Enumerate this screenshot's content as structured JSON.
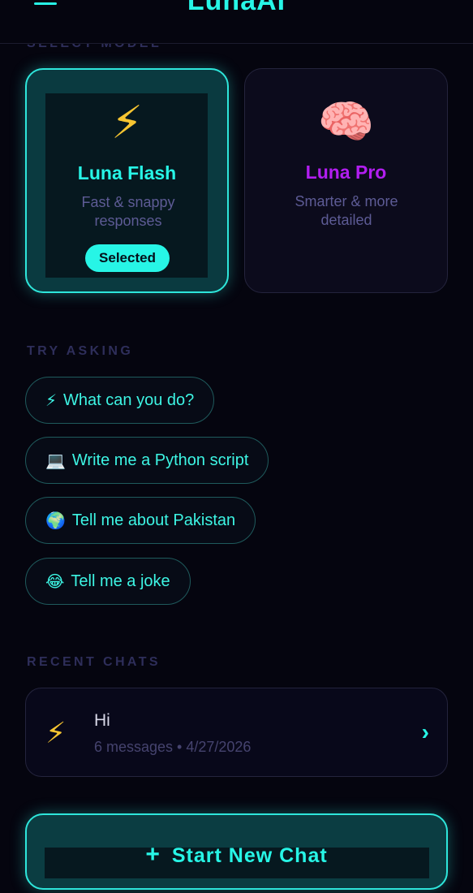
{
  "header": {
    "title": "LunaAI",
    "menu_icon": "hamburger-menu-icon"
  },
  "sections": {
    "select_model": "SELECT MODEL",
    "try_asking": "TRY ASKING",
    "recent_chats": "RECENT CHATS"
  },
  "models": [
    {
      "emoji": "⚡",
      "name": "Luna Flash",
      "description": "Fast & snappy responses",
      "badge": "Selected",
      "selected": true
    },
    {
      "emoji": "🧠",
      "name": "Luna Pro",
      "description": "Smarter & more detailed",
      "selected": false
    }
  ],
  "suggestions": [
    {
      "emoji": "⚡",
      "text": "What can you do?"
    },
    {
      "emoji": "💻",
      "text": "Write me a Python script"
    },
    {
      "emoji": "🌍",
      "text": "Tell me about Pakistan"
    },
    {
      "emoji": "😂",
      "text": "Tell me a joke"
    }
  ],
  "recent_chats": [
    {
      "emoji": "⚡",
      "title": "Hi",
      "meta": "6 messages • 4/27/2026",
      "chevron": "›"
    }
  ],
  "start_button": {
    "plus": "+",
    "label": "Start New Chat"
  },
  "colors": {
    "accent": "#27f5e6",
    "pro_accent": "#b21ef0",
    "background": "#05050f",
    "muted_label": "#2e2e5a"
  }
}
